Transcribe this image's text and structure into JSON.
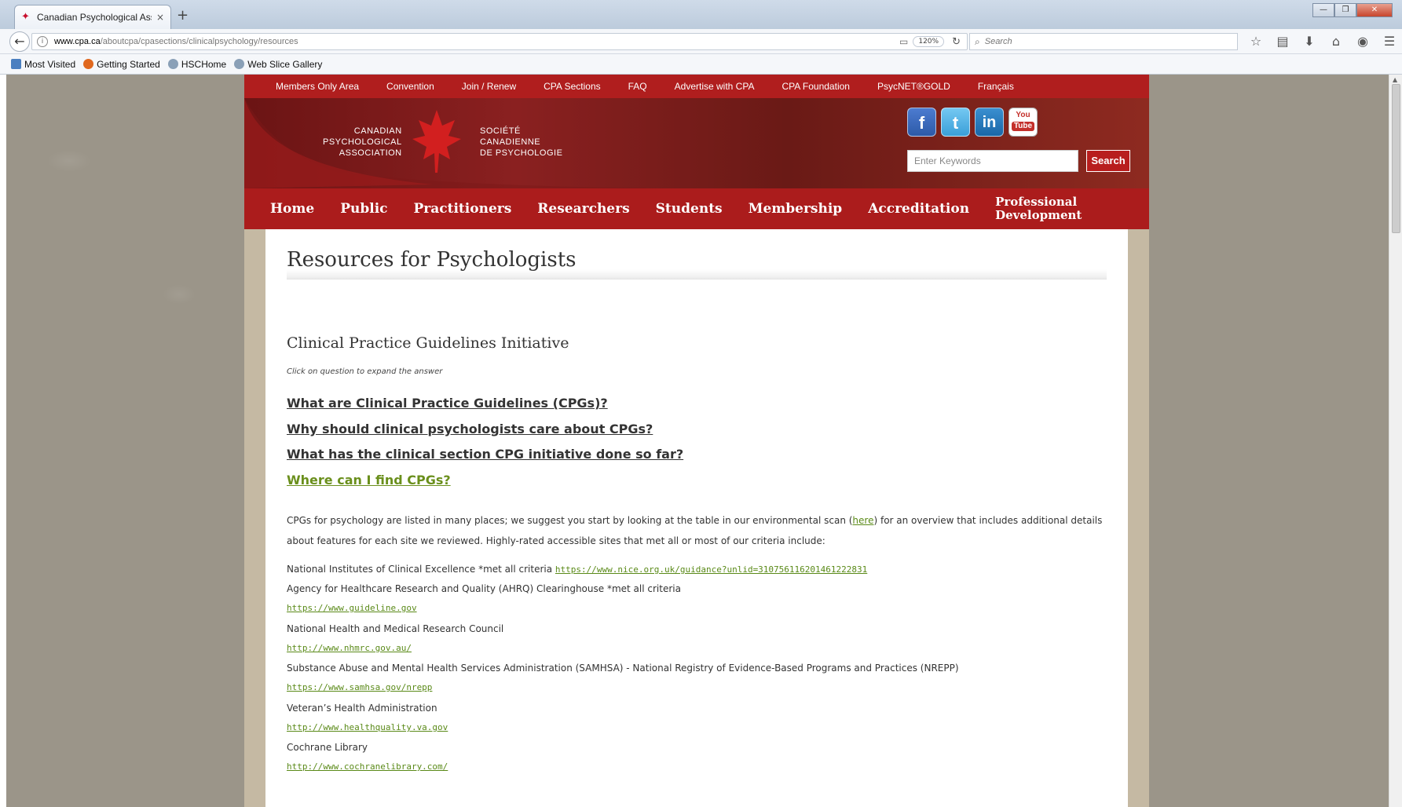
{
  "browser": {
    "tab_title": "Canadian Psychological Asso",
    "tab_close": "×",
    "new_tab": "+",
    "url_host": "www.cpa.ca",
    "url_path": "/aboutcpa/cpasections/clinicalpsychology/resources",
    "zoom": "120%",
    "search_placeholder": "Search",
    "bookmarks": [
      "Most Visited",
      "Getting Started",
      "HSCHome",
      "Web Slice Gallery"
    ]
  },
  "site": {
    "top_nav": [
      "Members Only Area",
      "Convention",
      "Join / Renew",
      "CPA Sections",
      "FAQ",
      "Advertise with CPA",
      "CPA Foundation",
      "PsycNET®GOLD",
      "Français"
    ],
    "logo_en": [
      "CANADIAN",
      "PSYCHOLOGICAL",
      "ASSOCIATION"
    ],
    "logo_fr": [
      "SOCIÉTÉ",
      "CANADIENNE",
      "DE PSYCHOLOGIE"
    ],
    "social": {
      "facebook": "f",
      "twitter": "t",
      "linkedin": "in",
      "youtube_top": "You",
      "youtube_bottom": "Tube"
    },
    "search_placeholder": "Enter Keywords",
    "search_button": "Search",
    "main_nav": [
      "Home",
      "Public",
      "Practitioners",
      "Researchers",
      "Students",
      "Membership",
      "Accreditation"
    ],
    "main_nav_last": "Professional Development"
  },
  "content": {
    "page_title": "Resources for Psychologists",
    "section_title": "Clinical Practice Guidelines Initiative",
    "hint": "Click on question to expand the answer",
    "faqs": [
      "What are Clinical Practice Guidelines (CPGs)?",
      "Why should clinical psychologists care about CPGs?",
      "What has the clinical section CPG initiative done so far?",
      "Where can I find CPGs?"
    ],
    "para_before": "CPGs for psychology are listed in many places; we suggest you start by looking at the table in our environmental scan (",
    "para_link": "here",
    "para_after": ") for an overview that includes additional details about features for each site we reviewed. Highly-rated accessible sites that met all or most of our criteria include:",
    "nice_text": "National Institutes of Clinical Excellence *met all criteria ",
    "nice_link": "https://www.nice.org.uk/guidance?unlid=310756116201461222831",
    "sites": [
      {
        "text": "Agency for Healthcare Research and Quality (AHRQ) Clearinghouse *met all criteria",
        "link": "https://www.guideline.gov"
      },
      {
        "text": "National Health and Medical Research Council",
        "link": "http://www.nhmrc.gov.au/"
      },
      {
        "text": "Substance Abuse and Mental Health Services Administration (SAMHSA) - National Registry of Evidence-Based Programs and Practices (NREPP)",
        "link": "https://www.samhsa.gov/nrepp"
      },
      {
        "text": "Veteran’s Health Administration",
        "link": "http://www.healthquality.va.gov"
      },
      {
        "text": "Cochrane Library",
        "link": "http://www.cochranelibrary.com/"
      }
    ]
  },
  "colors": {
    "brand_red": "#ab1c1c",
    "link_green": "#5a8a18",
    "page_bg": "#9b9589"
  }
}
